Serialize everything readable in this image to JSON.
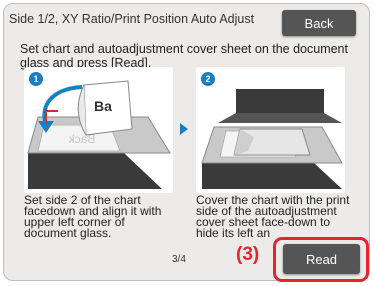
{
  "screen": {
    "title": "Side 1/2, XY Ratio/Print Position Auto Adjust",
    "back_label": "Back",
    "instruction": "Set chart and autoadjustment cover sheet on the document glass and press [Read]."
  },
  "steps": [
    {
      "number": "1",
      "illustration_text": "Ba",
      "illustration_mirrored": "Back",
      "caption": "Set side 2 of the chart facedown and align it with upper left corner of document glass."
    },
    {
      "number": "2",
      "caption": "Cover the chart with the print side of the autoadjustment cover sheet face-down to hide its left an"
    }
  ],
  "footer": {
    "page_indicator": "3/4",
    "read_label": "Read",
    "callout": "(3)"
  },
  "colors": {
    "accent_blue": "#1a7fc1",
    "button_gray": "#555555",
    "highlight_red": "#e0262e"
  }
}
